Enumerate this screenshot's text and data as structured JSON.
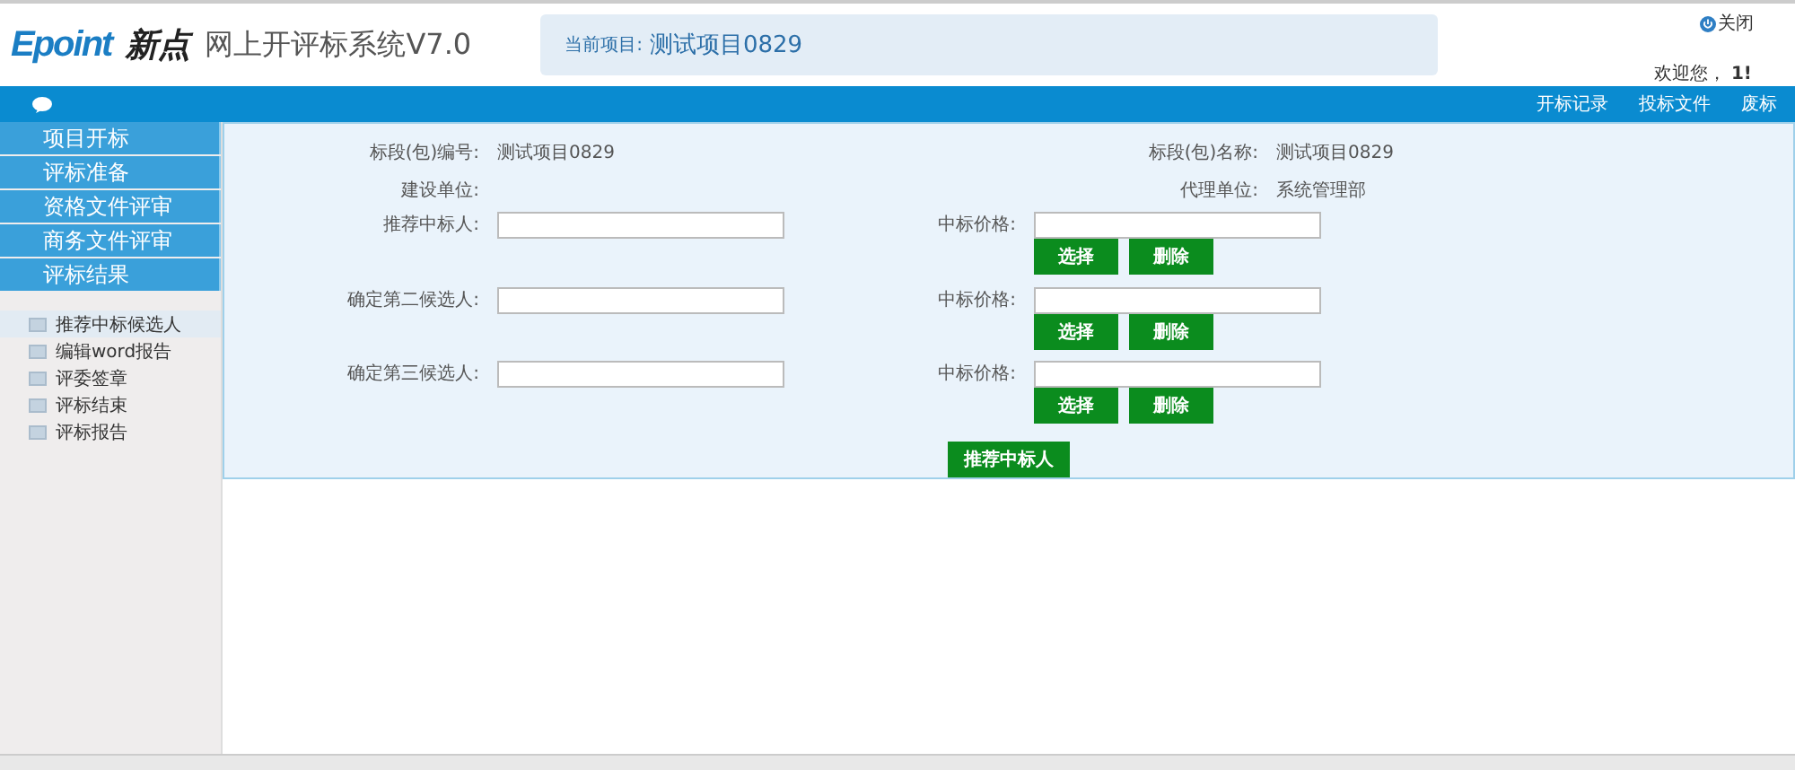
{
  "header": {
    "logo_brand": "Epoint",
    "logo_name": "新点",
    "system_title": "网上开评标系统V7.0",
    "current_project_label": "当前项目:",
    "current_project": "测试项目0829",
    "close": "关闭",
    "welcome": "欢迎您， **1!**"
  },
  "nav": {
    "links": [
      "开标记录",
      "投标文件",
      "废标"
    ]
  },
  "sidebar": {
    "sections": [
      {
        "label": "项目开标"
      },
      {
        "label": "评标准备"
      },
      {
        "label": "资格文件评审"
      },
      {
        "label": "商务文件评审"
      },
      {
        "label": "评标结果"
      }
    ],
    "items": [
      {
        "label": "推荐中标候选人",
        "selected": true
      },
      {
        "label": "编辑word报告",
        "selected": false
      },
      {
        "label": "评委签章",
        "selected": false
      },
      {
        "label": "评标结束",
        "selected": false
      },
      {
        "label": "评标报告",
        "selected": false
      }
    ]
  },
  "form": {
    "info_rows": [
      {
        "label_left": "标段(包)编号:",
        "value_left": "测试项目0829",
        "label_right": "标段(包)名称:",
        "value_right": "测试项目0829"
      },
      {
        "label_left": "建设单位:",
        "label_right": "代理单位:",
        "value_right": "系统管理部"
      }
    ],
    "candidates": [
      {
        "label": "推荐中标人:",
        "price_label": "中标价格:",
        "buttons": [
          "选择",
          "删除"
        ]
      },
      {
        "label": "确定第二候选人:",
        "price_label": "中标价格:",
        "buttons": [
          "选择",
          "删除"
        ]
      },
      {
        "label": "确定第三候选人:",
        "price_label": "中标价格:",
        "buttons": [
          "选择",
          "删除"
        ]
      }
    ],
    "submit": "推荐中标人"
  }
}
